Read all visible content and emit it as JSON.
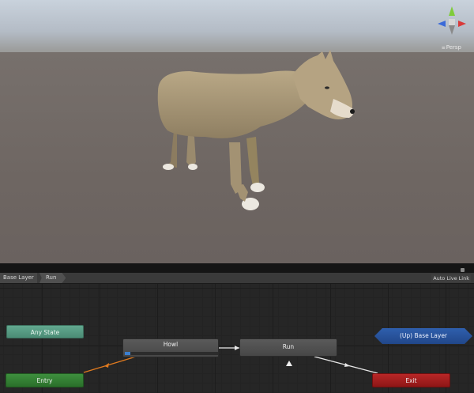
{
  "scene": {
    "view_label": "Persp",
    "gizmo": {
      "colors": {
        "x": "#d93a3a",
        "y": "#7fcc3a",
        "z": "#3a6ad9"
      }
    },
    "sky_color": "#c4cdd7",
    "ground_color": "#6e6662"
  },
  "toolbar": {
    "breadcrumbs": [
      "Base Layer",
      "Run"
    ],
    "auto_live_link_label": "Auto Live Link"
  },
  "graph": {
    "nodes": {
      "any_state": "Any State",
      "entry": "Entry",
      "exit": "Exit",
      "howl": "Howl",
      "run": "Run",
      "up_base_layer": "(Up) Base Layer"
    },
    "howl_progress": 0.06,
    "colors": {
      "any_state": "#55997f",
      "entry": "#338033",
      "exit": "#a01d1d",
      "state": "#505050",
      "up_layer": "#2a55a0",
      "default_transition": "#e07a1f",
      "transition": "#e8e8e8"
    }
  }
}
